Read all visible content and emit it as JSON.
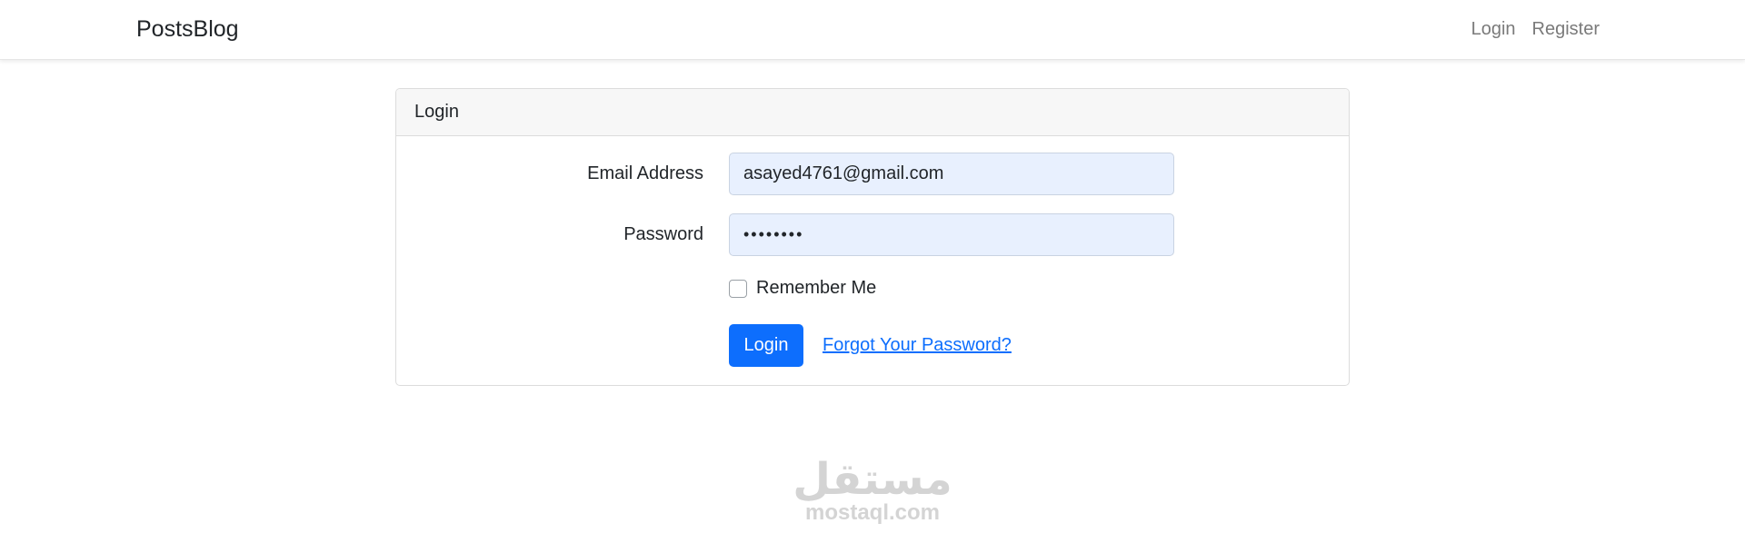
{
  "navbar": {
    "brand": "PostsBlog",
    "links": [
      "Login",
      "Register"
    ]
  },
  "card": {
    "header": "Login",
    "email_label": "Email Address",
    "email_value": "asayed4761@gmail.com",
    "password_label": "Password",
    "password_value": "••••••••",
    "remember_label": "Remember Me",
    "login_button": "Login",
    "forgot_link": "Forgot Your Password?"
  },
  "watermark": {
    "arabic": "مستقل",
    "latin": "mostaql.com"
  },
  "colors": {
    "primary": "#0d6efd",
    "input_bg": "#e8f0fe",
    "header_bg": "#f7f7f7"
  }
}
